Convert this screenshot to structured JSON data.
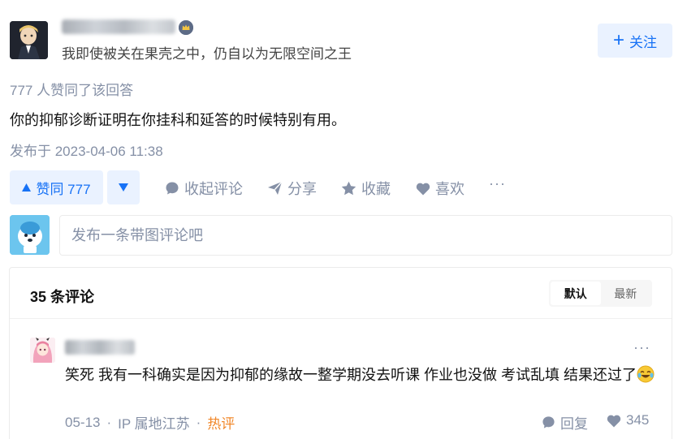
{
  "author": {
    "name": "",
    "bio": "我即使被关在果壳之中，仍自以为无限空间之王"
  },
  "follow_label": "关注",
  "vote_summary": "777 人赞同了该回答",
  "answer_text": "你的抑郁诊断证明在你挂科和延答的时候特别有用。",
  "publish_time": "发布于 2023-04-06 11:38",
  "actions": {
    "upvote_label": "赞同 777",
    "downvote_icon": "▼",
    "collapse_comments": "收起评论",
    "share": "分享",
    "favorite": "收藏",
    "like": "喜欢",
    "more": "···"
  },
  "comment_input": {
    "placeholder": "发布一条带图评论吧"
  },
  "comments": {
    "title": "35 条评论",
    "sort_tabs": [
      "默认",
      "最新"
    ],
    "active_sort": "默认",
    "items": [
      {
        "author": "",
        "text": "笑死 我有一科确实是因为抑郁的缘故一整学期没去听课 作业也没做 考试乱填 结果还过了",
        "date": "05-13",
        "location": "IP 属地江苏",
        "tag": "热评",
        "reply_label": "回复",
        "likes": "345",
        "more": "···"
      }
    ]
  },
  "colors": {
    "brand_blue": "#1772f6",
    "brand_blue_bg": "#eaf2ff",
    "muted_text": "#8590a6",
    "hot_tag": "#f1882b"
  },
  "icons": [
    "plus-icon",
    "upvote-triangle-icon",
    "downvote-triangle-icon",
    "comment-bubble-icon",
    "share-arrow-icon",
    "star-icon",
    "heart-icon",
    "more-dots-icon",
    "crown-badge-icon",
    "reply-bubble-icon",
    "laugh-cry-emoji"
  ]
}
